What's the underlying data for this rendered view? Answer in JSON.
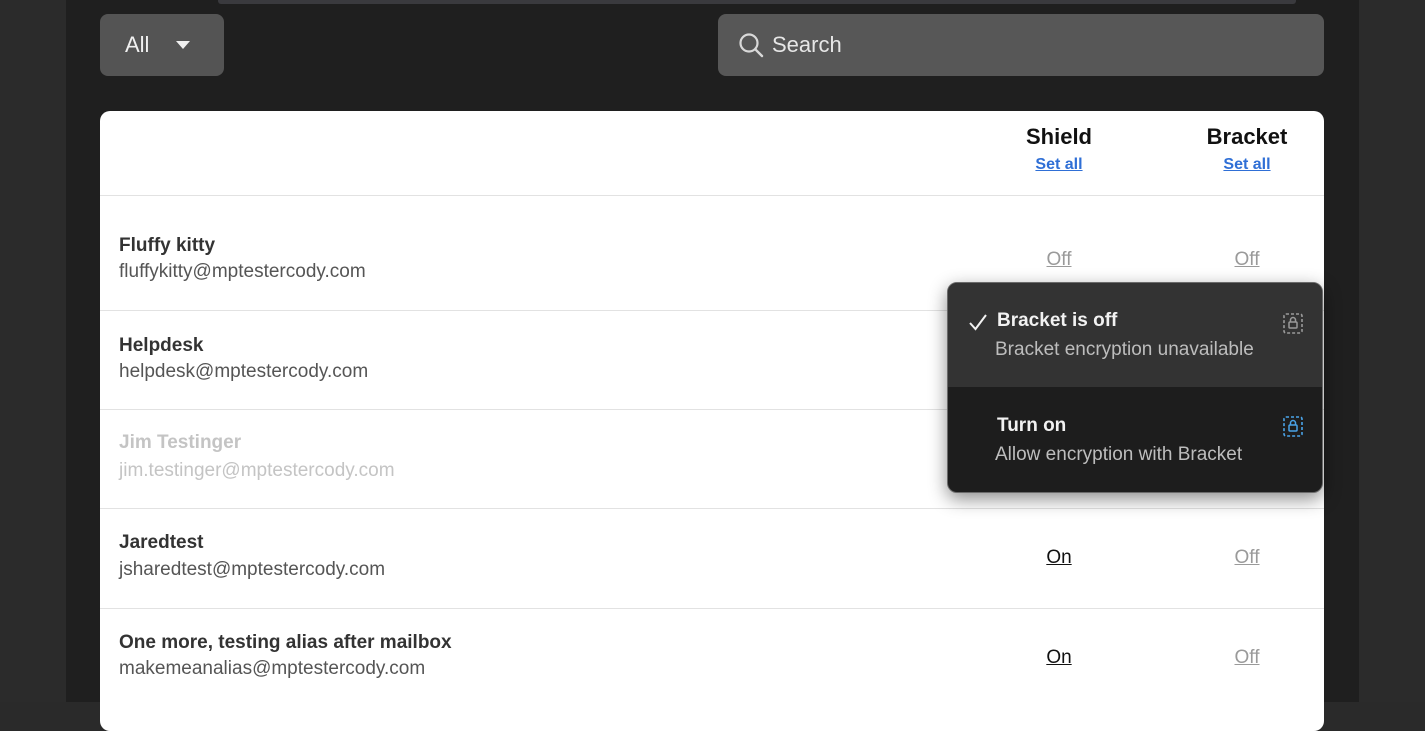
{
  "filter": {
    "label": "All"
  },
  "search": {
    "placeholder": "Search"
  },
  "columns": {
    "shield": {
      "title": "Shield",
      "set_all": "Set all"
    },
    "bracket": {
      "title": "Bracket",
      "set_all": "Set all"
    }
  },
  "rows": [
    {
      "name": "Fluffy kitty",
      "email": "fluffykitty@mptestercody.com",
      "shield": "Off",
      "bracket": "Off",
      "disabled": false
    },
    {
      "name": "Helpdesk",
      "email": "helpdesk@mptestercody.com",
      "shield": "",
      "bracket": "",
      "disabled": false
    },
    {
      "name": "Jim Testinger",
      "email": "jim.testinger@mptestercody.com",
      "shield": "",
      "bracket": "",
      "disabled": true
    },
    {
      "name": "Jaredtest",
      "email": "jsharedtest@mptestercody.com",
      "shield": "On",
      "bracket": "Off",
      "disabled": false
    },
    {
      "name": "One more, testing alias after mailbox",
      "email": "makemeanalias@mptestercody.com",
      "shield": "On",
      "bracket": "Off",
      "disabled": false
    }
  ],
  "popup": {
    "items": [
      {
        "title": "Bracket is off",
        "subtitle": "Bracket encryption unavailable",
        "selected": true,
        "icon": "lock-icon",
        "icon_color": "#9a9a9a"
      },
      {
        "title": "Turn on",
        "subtitle": "Allow encryption with Bracket",
        "selected": false,
        "icon": "lock-icon",
        "icon_color": "#4aa3e8"
      }
    ]
  },
  "colors": {
    "link": "#2f6fd6",
    "accent_lock": "#4aa3e8"
  }
}
